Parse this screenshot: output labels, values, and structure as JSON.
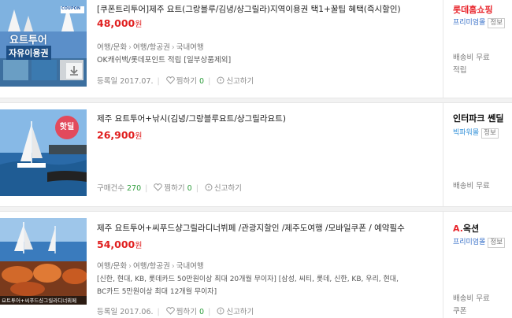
{
  "items": [
    {
      "thumb_text_1": "요트투어",
      "thumb_text_2": "자유이용권",
      "thumb_badge": "COUPON",
      "title": "[쿠폰트리투어]제주 요트(그랑블루/김녕/샹그릴라)지역이용권 택1+꿀팁 혜택(즉시할인)",
      "price": "48,000",
      "won": "원",
      "category": [
        "여행/문화",
        "여행/항공권",
        "국내여행"
      ],
      "desc": "OK캐쉬백/롯데포인트 적립 [일부상품제외]",
      "meta_label": "등록일 2017.07.",
      "wish_label": "찜하기",
      "wish_count": "0",
      "report_label": "신고하기",
      "shop": "롯데홈쇼핑",
      "grade": "프리미엄몰",
      "info": "정보",
      "ship": "배송비 무료",
      "ship2": "적립"
    },
    {
      "hot_label": "핫딜",
      "title": "제주 요트투어+낚시(김녕/그랑블루요트/샹그릴라요트)",
      "price": "26,900",
      "won": "원",
      "meta_label": "구매건수",
      "meta_count": "270",
      "wish_label": "찜하기",
      "wish_count": "0",
      "report_label": "신고하기",
      "shop": "인터파크 쎈딜",
      "grade": "빅파워몰",
      "info": "정보",
      "ship": "배송비 무료"
    },
    {
      "thumb_caption": "요트투어+씨푸드샹그릴라디너뷔페",
      "title": "제주 요트투어+씨푸드샹그릴라디너뷔페 /관광지할인 /제주도여행 /모바일쿠폰 / 예약필수",
      "price": "54,000",
      "won": "원",
      "category": [
        "여행/문화",
        "여행/항공권",
        "국내여행"
      ],
      "desc_line1": "[신한, 현대, KB, 롯데카드 50만원이상 최대 20개월 무이자] [삼성, 씨티, 롯데, 신한, KB, 우리, 현대,",
      "desc_line2": "BC카드 5만원이상 최대 12개월 무이자]",
      "meta_label": "등록일 2017.06.",
      "wish_label": "찜하기",
      "wish_count": "0",
      "report_label": "신고하기",
      "shop": "옥션",
      "grade": "프리미엄몰",
      "info": "정보",
      "ship": "배송비 무료",
      "ship2": "쿠폰"
    }
  ],
  "colors": {
    "price": "#e01e1e",
    "accent_blue": "#3a72c9",
    "count_green": "#2e9d3c",
    "auction_red": "#e8232a"
  },
  "icons": [
    "heart-icon",
    "siren-icon",
    "download-icon"
  ]
}
